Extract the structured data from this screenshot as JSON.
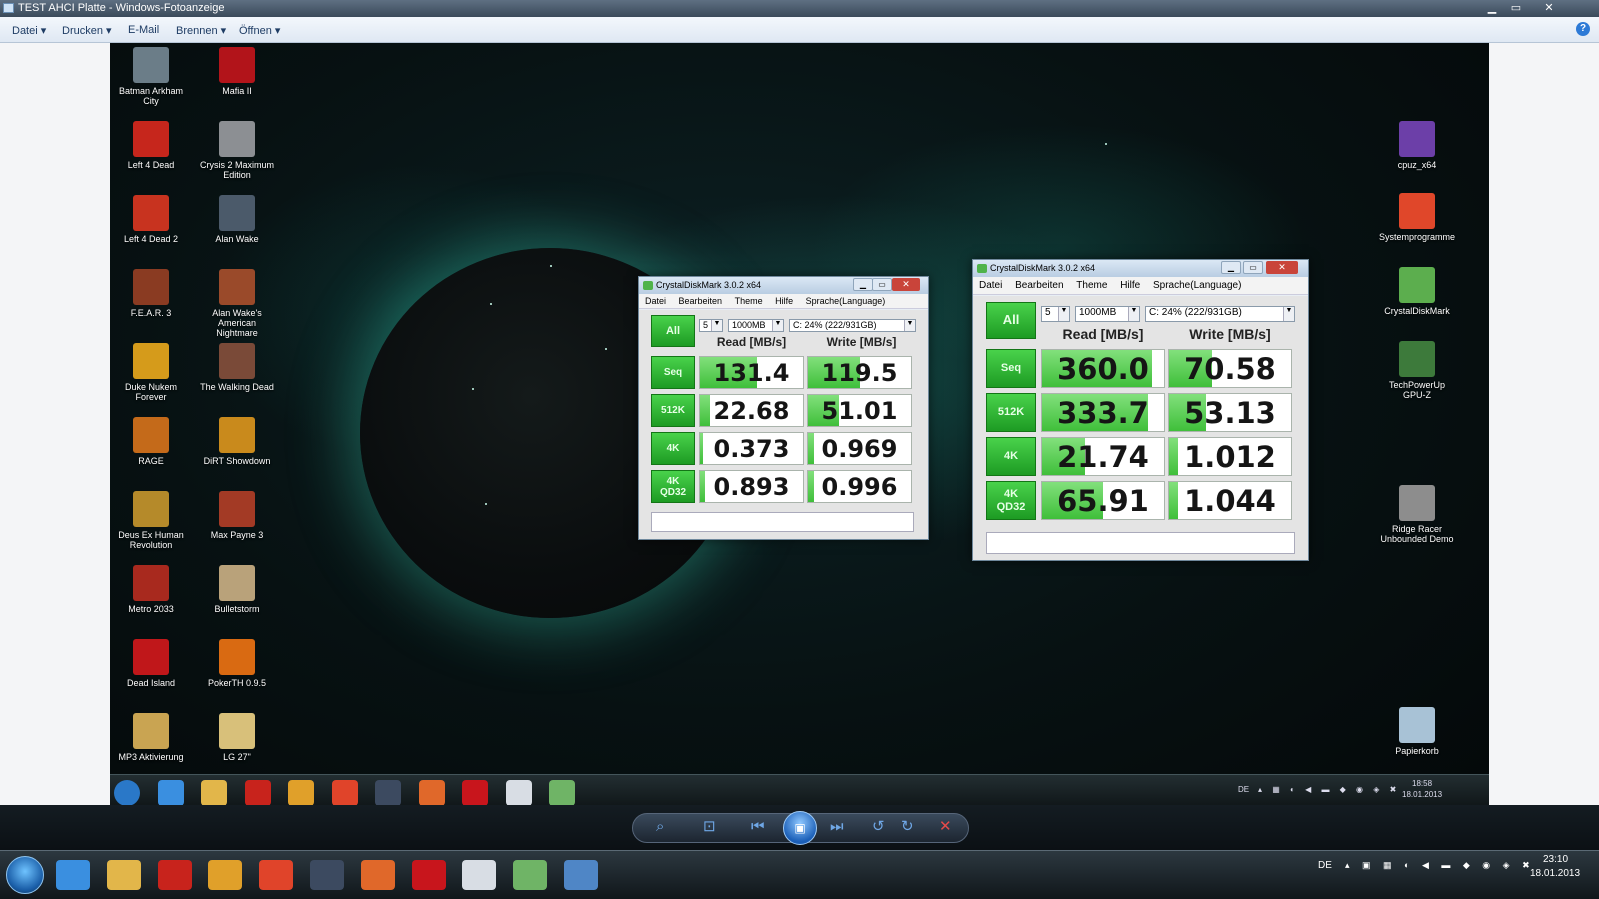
{
  "window": {
    "title": "TEST AHCI Platte - Windows-Fotoanzeige",
    "min": "▁",
    "max": "▭",
    "close": "✕"
  },
  "menu": {
    "datei": "Datei",
    "drucken": "Drucken",
    "email": "E-Mail",
    "brennen": "Brennen",
    "oeffnen": "Öffnen",
    "help": "?"
  },
  "desktop_icons_left": [
    {
      "label": "Batman Arkham City",
      "color": "#6b7d88"
    },
    {
      "label": "Mafia II",
      "color": "#b2141a"
    },
    {
      "label": "Left 4 Dead",
      "color": "#c6261c"
    },
    {
      "label": "Crysis 2 Maximum Edition",
      "color": "#8c8f93"
    },
    {
      "label": "Left 4 Dead 2",
      "color": "#c8331f"
    },
    {
      "label": "Alan Wake",
      "color": "#4b5a6a"
    },
    {
      "label": "F.E.A.R. 3",
      "color": "#8a3b22"
    },
    {
      "label": "Alan Wake's American Nightmare",
      "color": "#9a4a2a"
    },
    {
      "label": "Duke Nukem Forever",
      "color": "#d59b1b"
    },
    {
      "label": "The Walking Dead",
      "color": "#7a4a38"
    },
    {
      "label": "RAGE",
      "color": "#c46a1a"
    },
    {
      "label": "DiRT Showdown",
      "color": "#c98a1c"
    },
    {
      "label": "Deus Ex Human Revolution",
      "color": "#b58a2a"
    },
    {
      "label": "Max Payne 3",
      "color": "#a33a25"
    },
    {
      "label": "Metro 2033",
      "color": "#a8291e"
    },
    {
      "label": "Bulletstorm",
      "color": "#b9a27a"
    },
    {
      "label": "Dead Island",
      "color": "#c0171a"
    },
    {
      "label": "PokerTH 0.9.5",
      "color": "#d96a12"
    },
    {
      "label": "MP3 Aktivierung",
      "color": "#c9a452"
    },
    {
      "label": "LG 27\"",
      "color": "#d8c07a"
    }
  ],
  "desktop_icons_right": [
    {
      "label": "cpuz_x64",
      "color": "#6c3fa8"
    },
    {
      "label": "Systemprogramme",
      "color": "#e0472a"
    },
    {
      "label": "CrystalDiskMark",
      "color": "#5cae4e"
    },
    {
      "label": "TechPowerUp GPU-Z",
      "color": "#3d7a3b"
    },
    {
      "label": "Ridge Racer Unbounded Demo",
      "color": "#8d8d8d"
    },
    {
      "label": "Papierkorb",
      "color": "#a8c2d6"
    }
  ],
  "inner_taskbar": {
    "lang": "DE",
    "time": "18:58",
    "date": "18.01.2013",
    "icons": [
      "start-orb-icon",
      "ie-icon",
      "explorer-icon",
      "acrobat-icon",
      "media-player-icon",
      "chrome-icon",
      "security-icon",
      "firefox-icon",
      "avira-icon",
      "app-icon",
      "crystaldiskmark-icon"
    ]
  },
  "cdm_small": {
    "title": "CrystalDiskMark 3.0.2 x64",
    "menu": [
      "Datei",
      "Bearbeiten",
      "Theme",
      "Hilfe",
      "Sprache(Language)"
    ],
    "all_label": "All",
    "runs": "5",
    "size": "1000MB",
    "drive": "C: 24% (222/931GB)",
    "read_header": "Read [MB/s]",
    "write_header": "Write [MB/s]",
    "rows": [
      {
        "label": "Seq",
        "read": "131.4",
        "write": "119.5",
        "read_fill": 0.55,
        "write_fill": 0.5
      },
      {
        "label": "512K",
        "read": "22.68",
        "write": "51.01",
        "read_fill": 0.1,
        "write_fill": 0.3
      },
      {
        "label": "4K",
        "read": "0.373",
        "write": "0.969",
        "read_fill": 0.03,
        "write_fill": 0.06
      },
      {
        "label": "4K\nQD32",
        "read": "0.893",
        "write": "0.996",
        "read_fill": 0.05,
        "write_fill": 0.06
      }
    ]
  },
  "cdm_large": {
    "title": "CrystalDiskMark 3.0.2 x64",
    "menu": [
      "Datei",
      "Bearbeiten",
      "Theme",
      "Hilfe",
      "Sprache(Language)"
    ],
    "all_label": "All",
    "runs": "5",
    "size": "1000MB",
    "drive": "C: 24% (222/931GB)",
    "read_header": "Read [MB/s]",
    "write_header": "Write [MB/s]",
    "rows": [
      {
        "label": "Seq",
        "read": "360.0",
        "write": "70.58",
        "read_fill": 0.9,
        "write_fill": 0.35
      },
      {
        "label": "512K",
        "read": "333.7",
        "write": "53.13",
        "read_fill": 0.87,
        "write_fill": 0.3
      },
      {
        "label": "4K",
        "read": "21.74",
        "write": "1.012",
        "read_fill": 0.35,
        "write_fill": 0.07
      },
      {
        "label": "4K\nQD32",
        "read": "65.91",
        "write": "1.044",
        "read_fill": 0.5,
        "write_fill": 0.07
      }
    ]
  },
  "viewer_controls": {
    "zoom": "⌕",
    "fit": "⊡",
    "prev": "⏮",
    "slideshow": "▣",
    "next": "⏭",
    "rotate_ccw": "↺",
    "rotate_cw": "↻",
    "delete": "✕"
  },
  "host_taskbar": {
    "lang": "DE",
    "time": "23:10",
    "date": "18.01.2013",
    "icons": [
      "ie-icon",
      "explorer-icon",
      "acrobat-icon",
      "media-player-icon",
      "chrome-icon",
      "security-icon",
      "firefox-icon",
      "avira-icon",
      "app-icon",
      "crystaldiskmark-icon",
      "photo-viewer-icon"
    ]
  },
  "colors": {
    "accent_green": "#2fb332",
    "close_red": "#c9443a",
    "titlebar": "#4a5a6c"
  }
}
